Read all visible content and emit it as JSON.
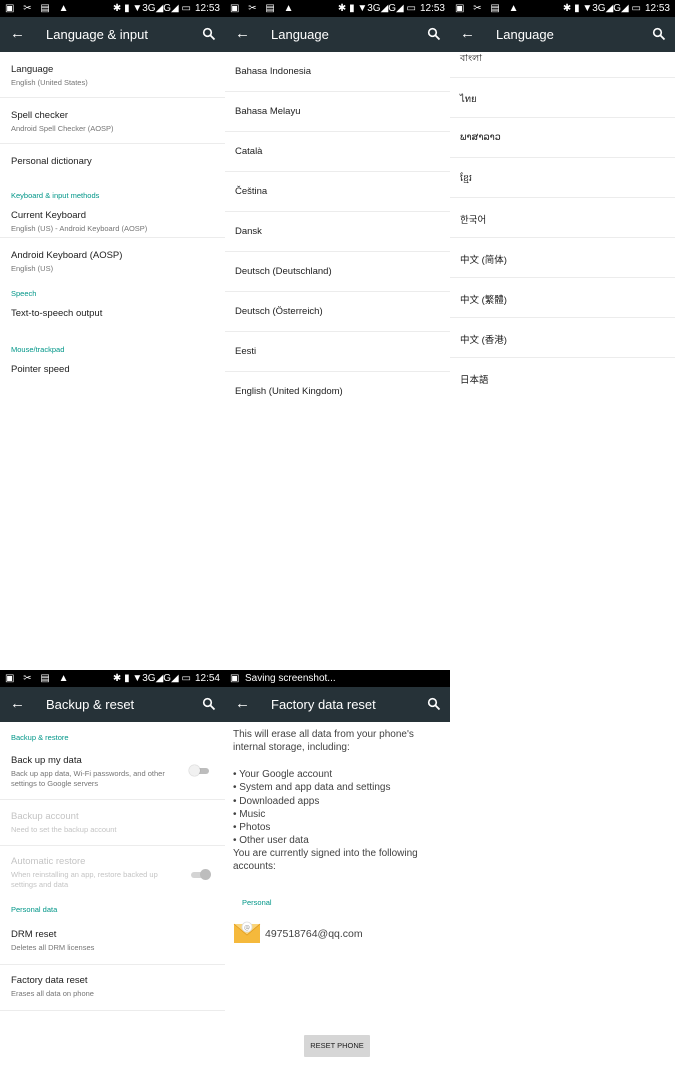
{
  "status": {
    "left_icons": "▣ ✂ ▤ ▲",
    "right_icons": "✱ ▮ ▼3G◢G◢  ▭",
    "time_a": "12:53",
    "time_b": "12:54",
    "saving": "Saving screenshot..."
  },
  "panel_input": {
    "title": "Language & input",
    "rows": [
      {
        "title": "Language",
        "subtitle": "English (United States)"
      },
      {
        "title": "Spell checker",
        "subtitle": "Android Spell Checker (AOSP)"
      },
      {
        "title": "Personal dictionary"
      }
    ],
    "section_keyboard": "Keyboard & input methods",
    "keyboard_rows": [
      {
        "title": "Current Keyboard",
        "subtitle": "English (US) - Android Keyboard (AOSP)"
      },
      {
        "title": "Android Keyboard (AOSP)",
        "subtitle": "English (US)"
      }
    ],
    "section_speech": "Speech",
    "speech_row": "Text-to-speech output",
    "section_mouse": "Mouse/trackpad",
    "mouse_row": "Pointer speed"
  },
  "panel_lang1": {
    "title": "Language",
    "items": [
      "Bahasa Indonesia",
      "Bahasa Melayu",
      "Català",
      "Čeština",
      "Dansk",
      "Deutsch (Deutschland)",
      "Deutsch (Österreich)",
      "Eesti",
      "English (United Kingdom)"
    ]
  },
  "panel_lang2": {
    "title": "Language",
    "items": [
      "বাংলা",
      "ไทย",
      "ພາສາລາວ",
      "ខ្មែរ",
      "한국어",
      "中文 (简体)",
      "中文 (繁體)",
      "中文 (香港)",
      "日本語"
    ]
  },
  "panel_backup": {
    "title": "Backup & reset",
    "section_backup": "Backup & restore",
    "backup_data": {
      "title": "Back up my data",
      "subtitle": "Back up app data, Wi-Fi passwords, and other settings to Google servers",
      "on": false
    },
    "backup_account": {
      "title": "Backup account",
      "subtitle": "Need to set the backup account"
    },
    "auto_restore": {
      "title": "Automatic restore",
      "subtitle": "When reinstalling an app, restore backed up settings and data",
      "on": true
    },
    "section_personal": "Personal data",
    "drm": {
      "title": "DRM reset",
      "subtitle": "Deletes all DRM licenses"
    },
    "factory": {
      "title": "Factory data reset",
      "subtitle": "Erases all data on phone"
    }
  },
  "panel_factory": {
    "title": "Factory data reset",
    "intro": "This will erase all data from your phone's internal storage, including:",
    "bullets": [
      "• Your Google account",
      "• System and app data and settings",
      "• Downloaded apps",
      "• Music",
      "• Photos",
      "• Other user data"
    ],
    "signed_in": "You are currently signed into the following accounts:",
    "section_personal": "Personal",
    "account": "497518764@qq.com",
    "reset_button": "RESET PHONE"
  },
  "colors": {
    "toolbar": "#263238",
    "accent": "#009688",
    "statusbar": "#000000"
  }
}
